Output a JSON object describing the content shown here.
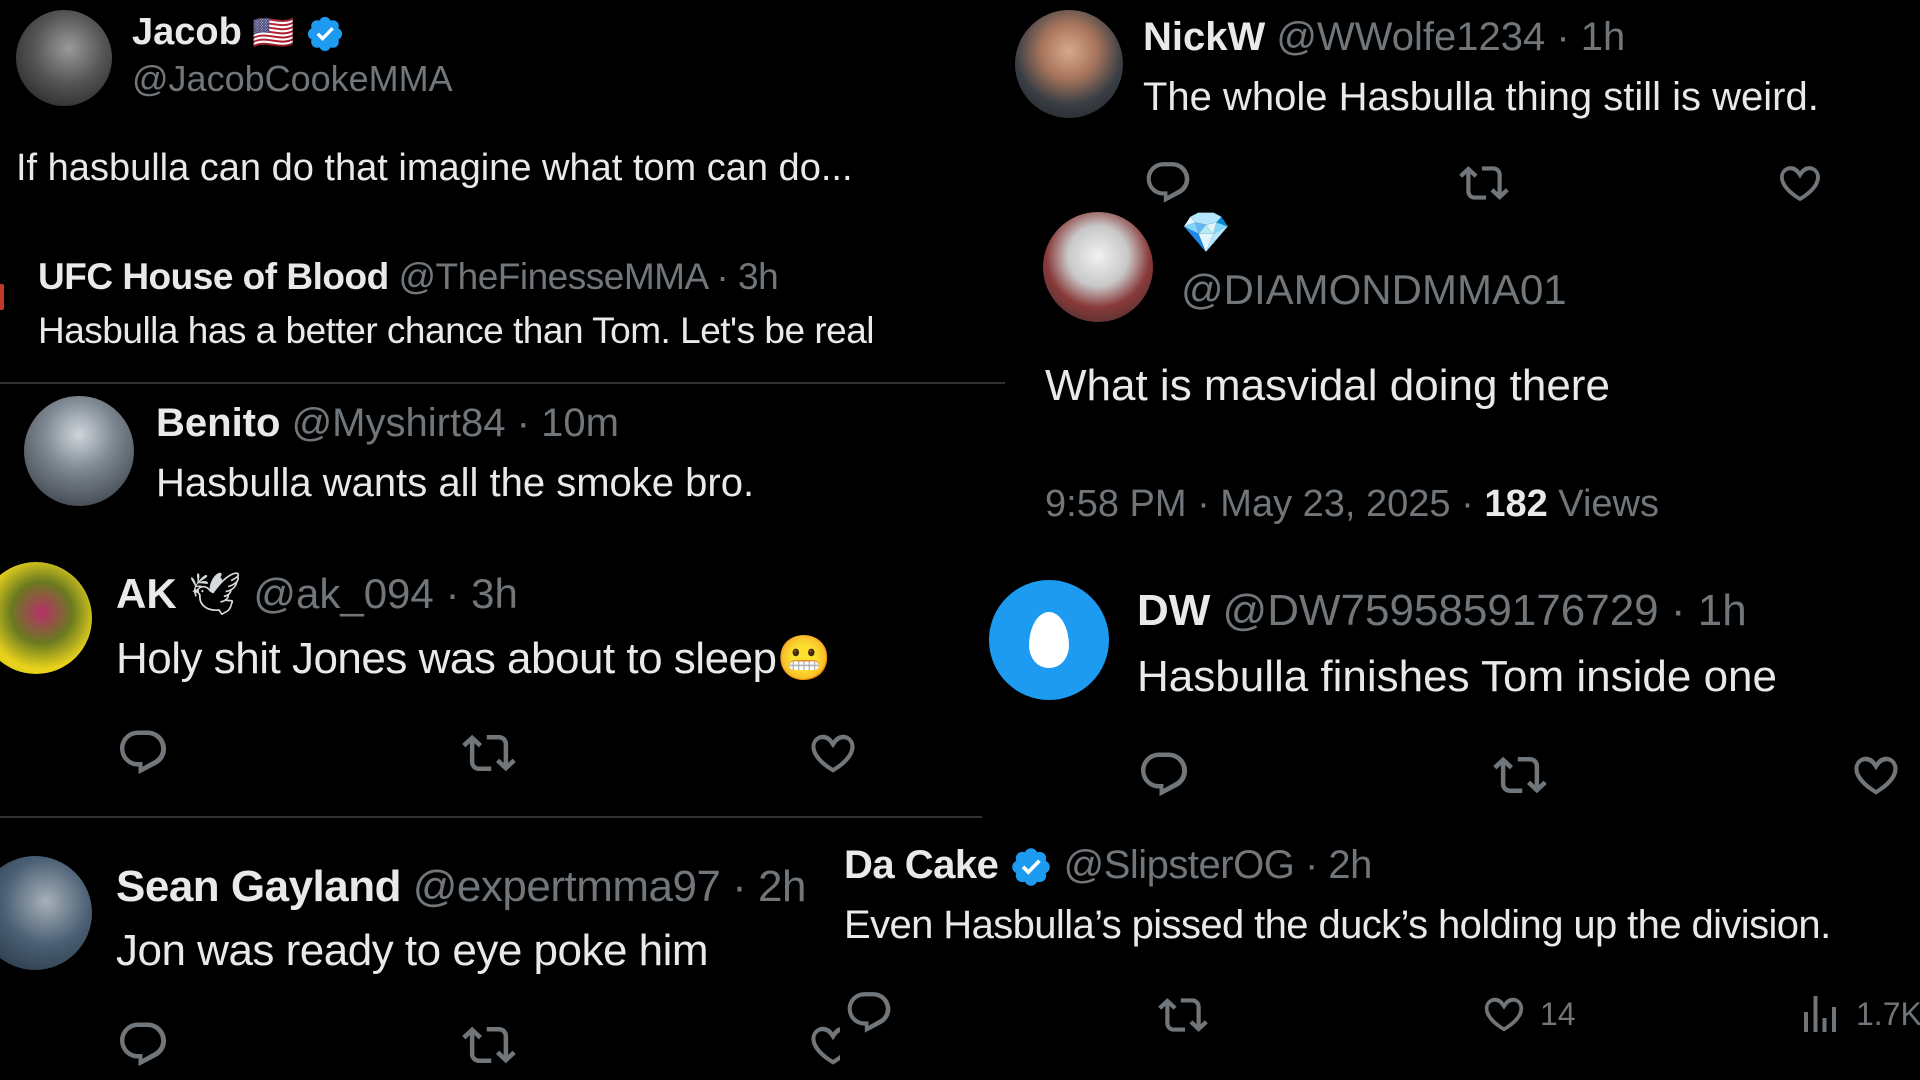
{
  "posts": {
    "jacob": {
      "name": "Jacob",
      "flag": "🇺🇸",
      "handle": "@JacobCookeMMA",
      "text": "If hasbulla can do that imagine what tom can do..."
    },
    "ufc": {
      "name": "UFC House of Blood",
      "handle": "@TheFinesseMMA",
      "time": "· 3h",
      "text": "Hasbulla has a better chance than Tom. Let's be real"
    },
    "benito": {
      "name": "Benito",
      "handle": "@Myshirt84",
      "time": "· 10m",
      "text": "Hasbulla wants all the smoke bro."
    },
    "ak": {
      "name": "AK",
      "emoji": "🕊",
      "handle": "@ak_094",
      "time": "· 3h",
      "text": "Holy shit Jones was about to sleep",
      "text_emoji": "😬"
    },
    "sean": {
      "name": "Sean Gayland",
      "handle": "@expertmma97",
      "time": "· 2h",
      "text": "Jon was ready to eye poke him"
    },
    "nick": {
      "name": "NickW",
      "handle": "@WWolfe1234",
      "time": "· 1h",
      "text": "The whole Hasbulla thing still is weird."
    },
    "diamond": {
      "emoji": "💎",
      "handle": "@DIAMONDMMA01",
      "text": "What is masvidal doing there",
      "meta_time": "9:58 PM · May 23, 2025 · ",
      "views_count": "182",
      "views_label": " Views"
    },
    "dw": {
      "name": "DW",
      "handle": "@DW7595859176729",
      "time": "· 1h",
      "text": "Hasbulla finishes Tom inside one"
    },
    "dacake": {
      "name": "Da Cake",
      "handle": "@SlipsterOG",
      "time": "· 2h",
      "text": "Even Hasbulla’s pissed the duck’s holding up the division.",
      "likes": "14",
      "views": "1.7K"
    }
  },
  "colors": {
    "background": "#000000",
    "text": "#e7e9ea",
    "muted": "#71767b",
    "verified": "#1d9bf0",
    "divider": "#2f3336",
    "default_avatar": "#1d9bf0"
  },
  "icons": [
    "verified-badge-icon",
    "reply-icon",
    "retweet-icon",
    "like-icon",
    "views-icon",
    "egg-avatar-icon"
  ]
}
